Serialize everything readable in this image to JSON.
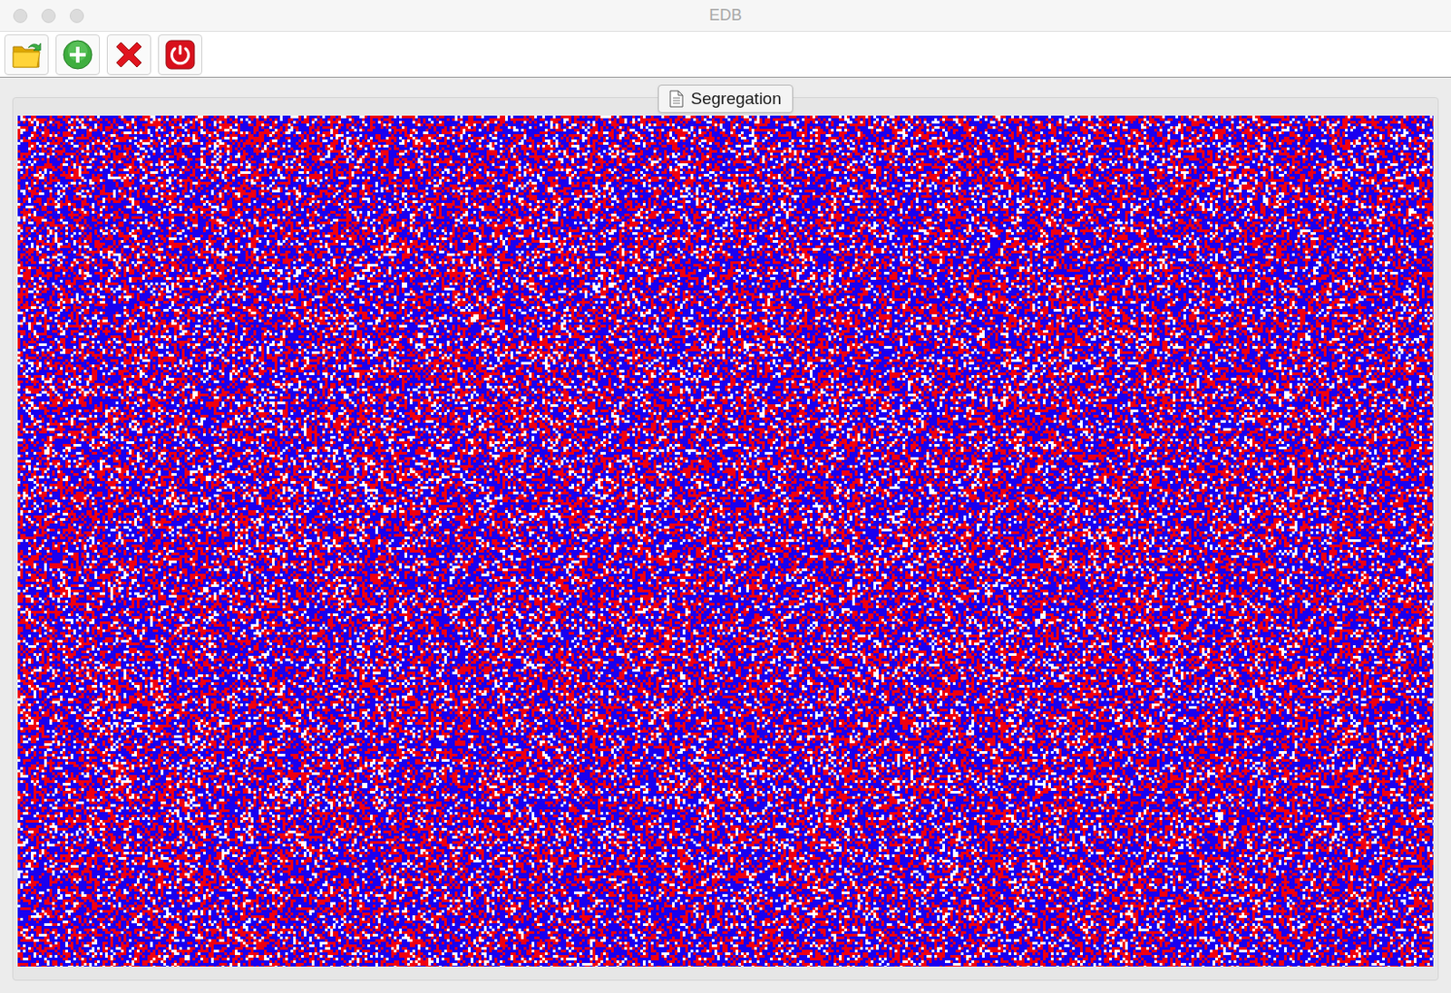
{
  "window": {
    "title": "EDB"
  },
  "tabs": [
    {
      "label": "Segregation",
      "selected": true
    }
  ],
  "grid": {
    "agents": [
      {
        "kind": "blue",
        "color": "#1a00f0",
        "share": 0.5
      },
      {
        "kind": "red",
        "color": "#f00010",
        "share": 0.36
      },
      {
        "kind": "empty",
        "color": "#ffffff",
        "share": 0.14
      }
    ]
  }
}
